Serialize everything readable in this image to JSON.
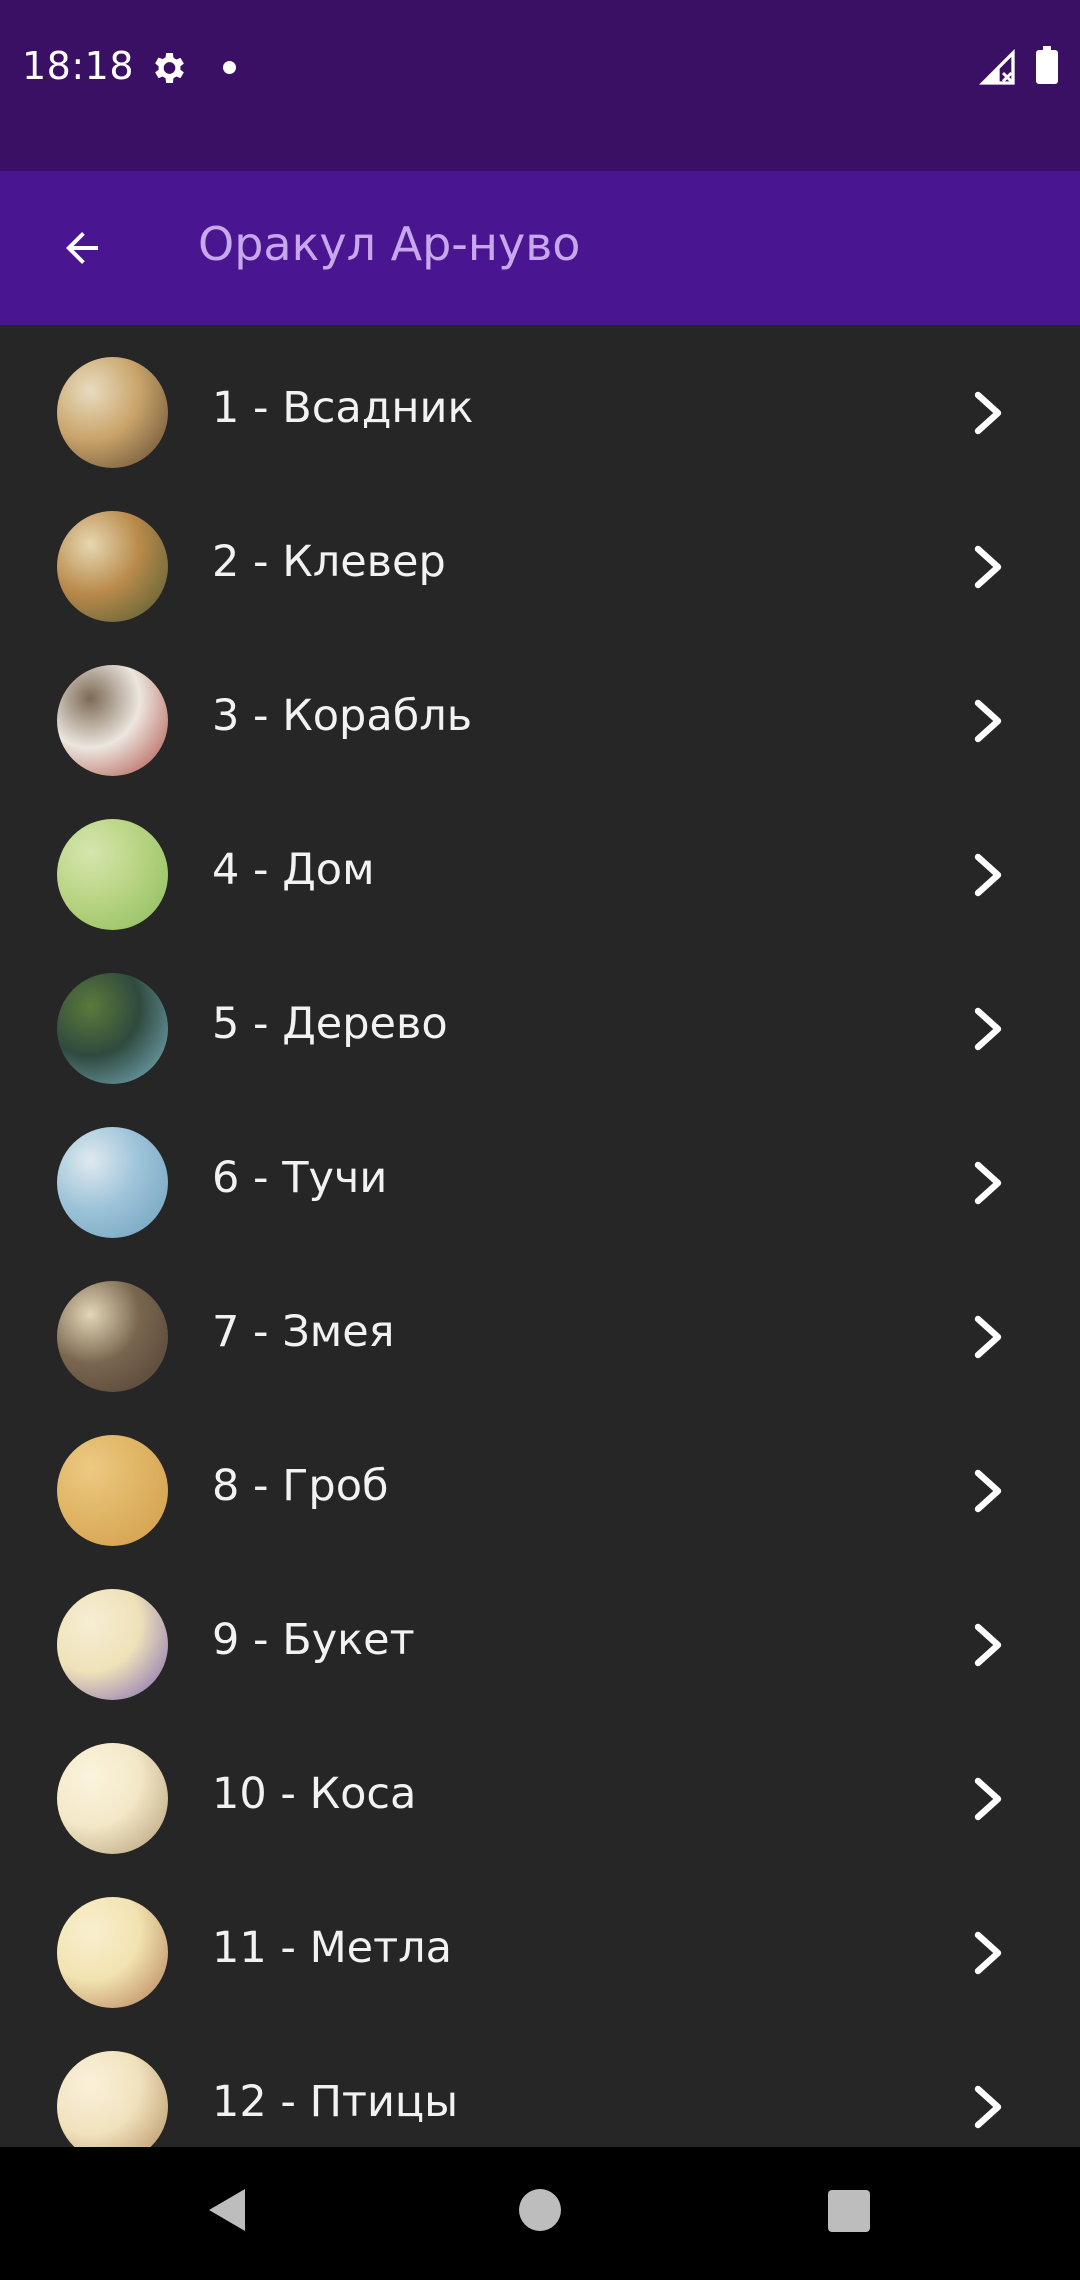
{
  "status_bar": {
    "time": "18:18",
    "icons": [
      "gear-icon",
      "notification-dot-icon",
      "signal-no-data-icon",
      "battery-full-icon"
    ]
  },
  "app_bar": {
    "back_icon": "arrow-left-icon",
    "title": "Оракул Ар-нуво"
  },
  "colors": {
    "status_bar_bg": "#3a1064",
    "app_bar_bg": "#4a1590",
    "title_text": "#c8a8ec",
    "list_bg": "#262626",
    "item_text": "#f2f2f2",
    "nav_bar_bg": "#000000"
  },
  "cards": [
    {
      "label": "1 - Всадник",
      "thumb_colors": [
        "#c9a46a",
        "#5b4630",
        "#e8dcc0"
      ]
    },
    {
      "label": "2 - Клевер",
      "thumb_colors": [
        "#b98a4a",
        "#4b5a32",
        "#e6d7b1"
      ]
    },
    {
      "label": "3 - Корабль",
      "thumb_colors": [
        "#ece6df",
        "#a9453a",
        "#7c6a54"
      ]
    },
    {
      "label": "4 - Дом",
      "thumb_colors": [
        "#b9d483",
        "#8bbc5c",
        "#d5e6ad"
      ]
    },
    {
      "label": "5 - Дерево",
      "thumb_colors": [
        "#2f4a3e",
        "#7fb5c9",
        "#5b7a3a"
      ]
    },
    {
      "label": "6 - Тучи",
      "thumb_colors": [
        "#9cc3d8",
        "#6e9fbd",
        "#dfe9ef"
      ]
    },
    {
      "label": "7 - Змея",
      "thumb_colors": [
        "#7a6650",
        "#4d3f31",
        "#e3d7b7"
      ]
    },
    {
      "label": "8 - Гроб",
      "thumb_colors": [
        "#e0b565",
        "#d29c4b",
        "#ecc982"
      ]
    },
    {
      "label": "9 - Букет",
      "thumb_colors": [
        "#efe2b8",
        "#7a62b3",
        "#f6eed4"
      ]
    },
    {
      "label": "10 - Коса",
      "thumb_colors": [
        "#f3e8c8",
        "#b39a72",
        "#fbf3de"
      ]
    },
    {
      "label": "11 - Метла",
      "thumb_colors": [
        "#f2e3b1",
        "#b27a52",
        "#f8efcf"
      ]
    },
    {
      "label": "12 - Птицы",
      "thumb_colors": [
        "#f1e2bd",
        "#b08a5c",
        "#faf1da"
      ]
    }
  ],
  "nav_bar": {
    "icons": [
      "nav-back-icon",
      "nav-home-icon",
      "nav-recents-icon"
    ]
  }
}
